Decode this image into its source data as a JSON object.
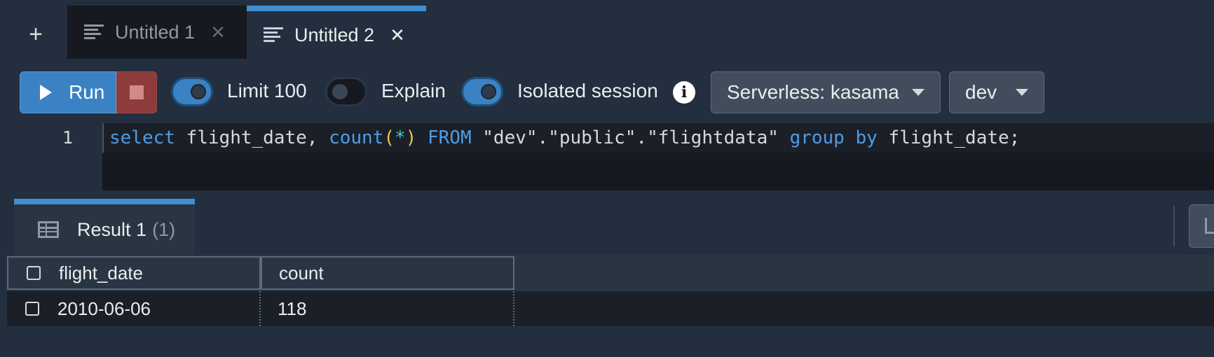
{
  "tabs": [
    {
      "label": "Untitled 1",
      "active": false
    },
    {
      "label": "Untitled 2",
      "active": true
    }
  ],
  "toolbar": {
    "run_label": "Run",
    "limit_label": "Limit 100",
    "limit_on": true,
    "explain_label": "Explain",
    "explain_on": false,
    "isolated_label": "Isolated session",
    "isolated_on": true,
    "workgroup_value": "Serverless: kasama",
    "database_value": "dev"
  },
  "editor": {
    "line_number": "1",
    "tokens": [
      {
        "t": "select",
        "c": "kw"
      },
      {
        "t": " flight_date, ",
        "c": ""
      },
      {
        "t": "count",
        "c": "kw"
      },
      {
        "t": "(",
        "c": "paren"
      },
      {
        "t": "*",
        "c": "star"
      },
      {
        "t": ")",
        "c": "paren"
      },
      {
        "t": " ",
        "c": ""
      },
      {
        "t": "FROM",
        "c": "kw"
      },
      {
        "t": " \"dev\".\"public\".\"flightdata\" ",
        "c": ""
      },
      {
        "t": "group",
        "c": "kw"
      },
      {
        "t": " ",
        "c": ""
      },
      {
        "t": "by",
        "c": "kw"
      },
      {
        "t": " flight_date;",
        "c": ""
      }
    ]
  },
  "results": {
    "tab_label": "Result 1",
    "tab_count": "(1)",
    "columns": [
      "flight_date",
      "count"
    ],
    "rows": [
      [
        "2010-06-06",
        "118"
      ]
    ]
  },
  "colors": {
    "accent": "#3f8fd2",
    "run": "#3b82c4",
    "stop": "#8e3b3b",
    "keyword": "#4e9be6",
    "paren": "#e8c547",
    "star": "#45c8c0"
  },
  "icons": [
    "add-tab-icon",
    "document-icon",
    "close-icon",
    "play-icon",
    "stop-icon",
    "info-icon",
    "chevron-down-icon",
    "table-icon",
    "export-icon",
    "checkbox-icon"
  ]
}
